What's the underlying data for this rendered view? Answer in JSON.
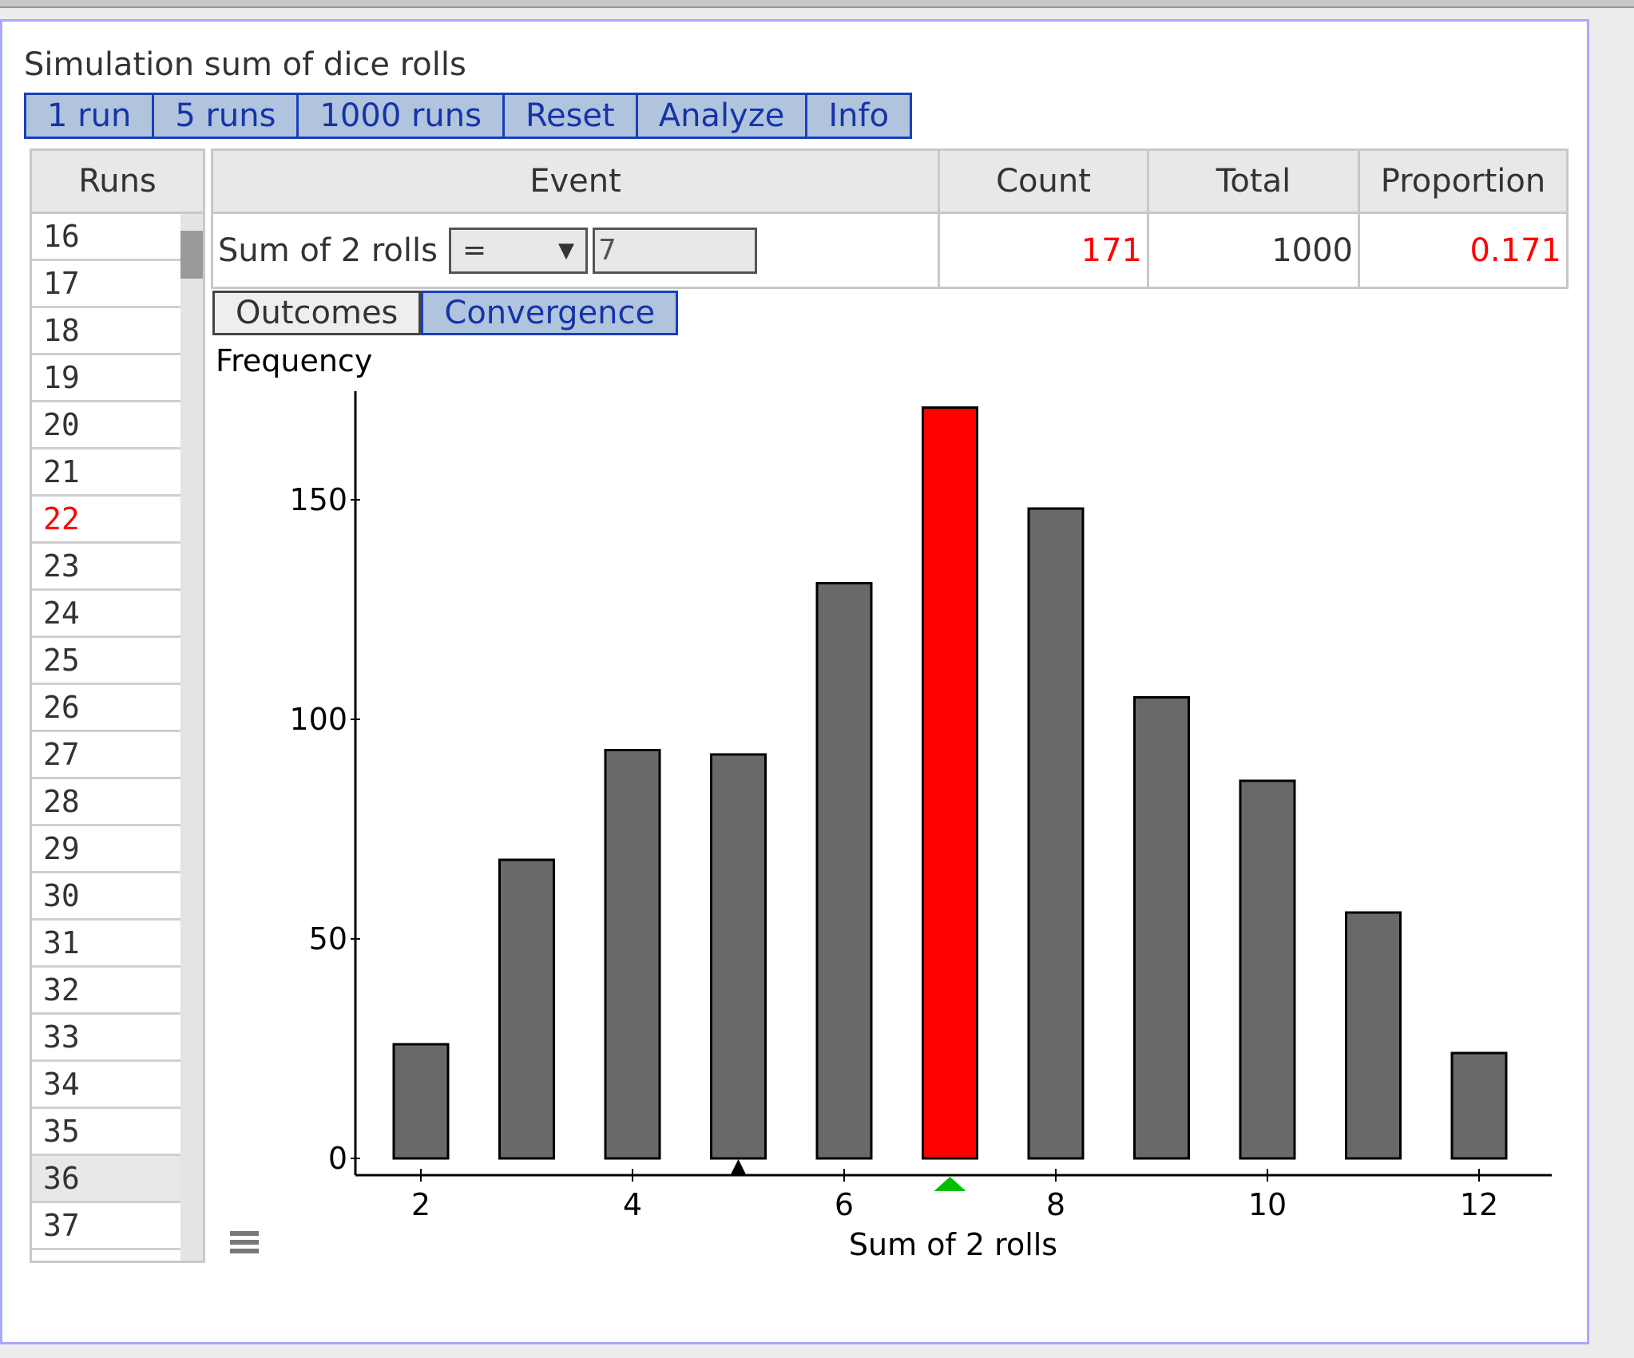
{
  "app": {
    "title": "Simulation sum of dice rolls"
  },
  "toolbar": {
    "buttons": [
      {
        "label": "1 run"
      },
      {
        "label": "5 runs"
      },
      {
        "label": "1000 runs"
      },
      {
        "label": "Reset"
      },
      {
        "label": "Analyze"
      },
      {
        "label": "Info"
      }
    ]
  },
  "runs": {
    "header": "Runs",
    "items": [
      "16",
      "17",
      "18",
      "19",
      "20",
      "21",
      "22",
      "23",
      "24",
      "25",
      "26",
      "27",
      "28",
      "29",
      "30",
      "31",
      "32",
      "33",
      "34",
      "35",
      "36",
      "37"
    ],
    "highlighted": "22",
    "selected": "36"
  },
  "event_table": {
    "headers": {
      "event": "Event",
      "count": "Count",
      "total": "Total",
      "proportion": "Proportion"
    },
    "row": {
      "event_label": "Sum of 2 rolls",
      "operator": "=",
      "value": "7",
      "count": "171",
      "total": "1000",
      "proportion": "0.171"
    }
  },
  "tabs": [
    {
      "label": "Outcomes",
      "active": false
    },
    {
      "label": "Convergence",
      "active": true
    }
  ],
  "colors": {
    "accent": "#1633a8",
    "button_bg": "#b0c4de",
    "highlight": "#ff0000",
    "bar": "#696969",
    "marker_green": "#00c000"
  },
  "chart_data": {
    "type": "bar",
    "title": "",
    "xlabel": "Sum of 2 rolls",
    "ylabel": "Frequency",
    "categories": [
      2,
      3,
      4,
      5,
      6,
      7,
      8,
      9,
      10,
      11,
      12
    ],
    "values": [
      26,
      68,
      93,
      92,
      131,
      171,
      148,
      105,
      86,
      56,
      24
    ],
    "highlight_category": 7,
    "xticks": [
      2,
      4,
      6,
      8,
      10,
      12
    ],
    "yticks": [
      0,
      50,
      100,
      150
    ],
    "xlim": [
      1.4,
      12.7
    ],
    "ylim": [
      0,
      175
    ],
    "markers": [
      {
        "x": 5,
        "color": "#000000",
        "position": "above-axis"
      },
      {
        "x": 7,
        "color": "#00c000",
        "position": "below-axis"
      }
    ],
    "grid": false,
    "legend": "none"
  }
}
